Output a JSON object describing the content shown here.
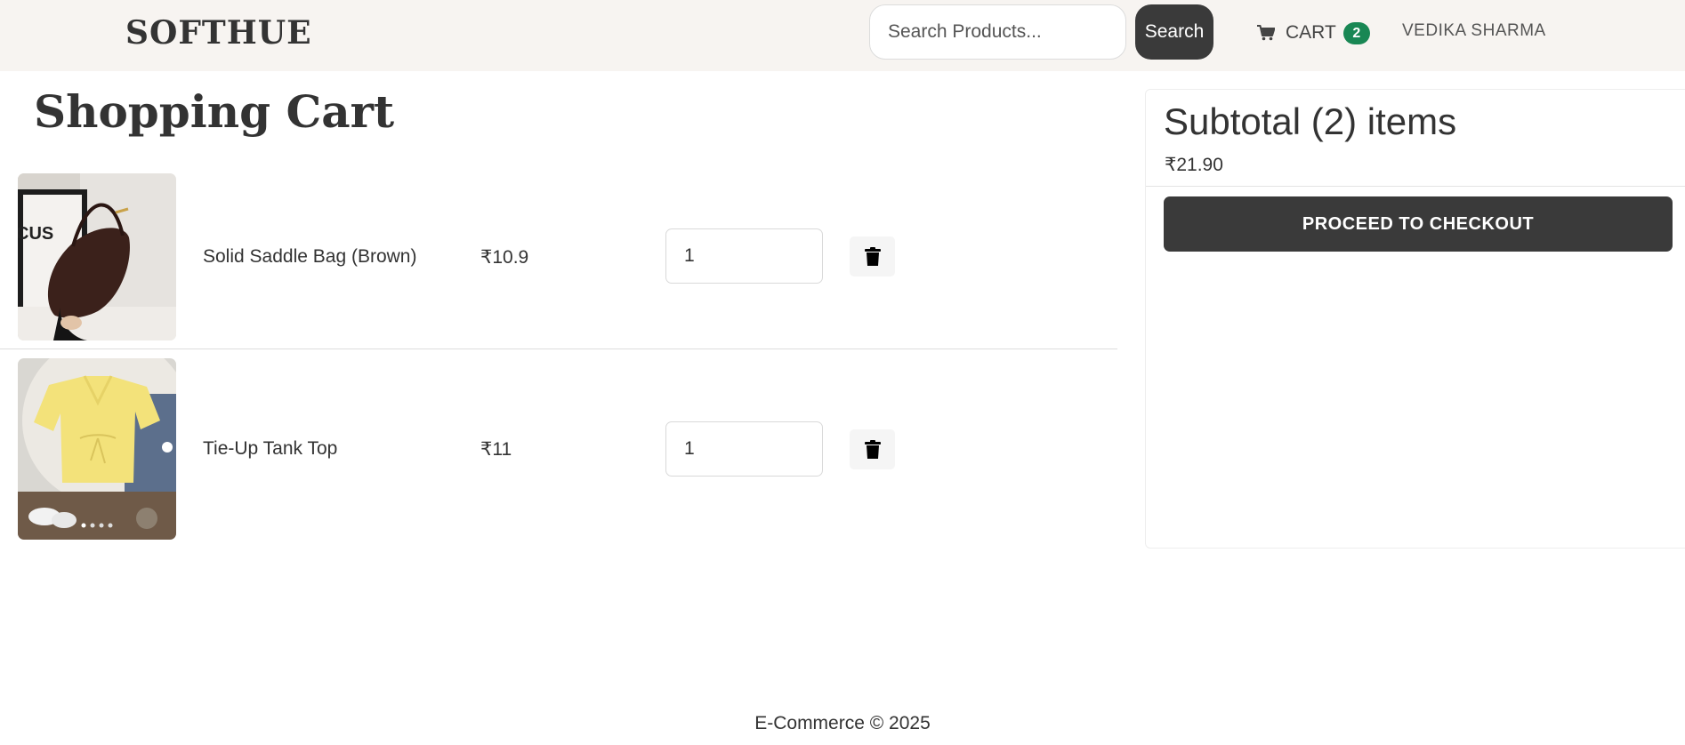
{
  "navbar": {
    "brand": "SOFTHUE",
    "search": {
      "placeholder": "Search Products...",
      "button_label": "Search"
    },
    "cart": {
      "label": "CART",
      "count": "2",
      "icon": "cart-icon"
    },
    "user_name": "VEDIKA SHARMA"
  },
  "page": {
    "title": "Shopping Cart"
  },
  "cart_items": [
    {
      "name": "Solid Saddle Bag (Brown)",
      "price": "₹10.9",
      "quantity": "1",
      "image": "brown-saddle-bag-photo",
      "delete_icon": "trash-icon"
    },
    {
      "name": "Tie-Up Tank Top",
      "price": "₹11",
      "quantity": "1",
      "image": "yellow-tie-up-top-photo",
      "delete_icon": "trash-icon"
    }
  ],
  "summary": {
    "title": "Subtotal (2) items",
    "amount": "₹21.90",
    "checkout_label": "PROCEED TO CHECKOUT"
  },
  "footer": {
    "text": "E-Commerce © 2025"
  },
  "colors": {
    "navbar_bg": "#f7f4f1",
    "dark_button": "#3a3a3a",
    "badge": "#198754",
    "text": "#333333"
  }
}
